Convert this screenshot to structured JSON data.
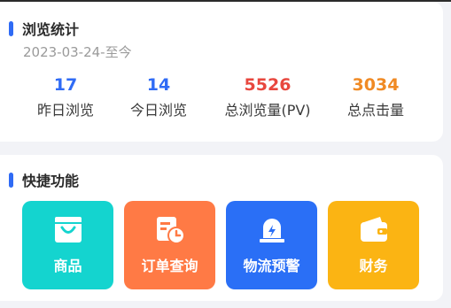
{
  "stats": {
    "title": "浏览统计",
    "date_range": "2023-03-24-至今",
    "metrics": [
      {
        "value": "17",
        "label": "昨日浏览",
        "color": "#2f6bf5"
      },
      {
        "value": "14",
        "label": "今日浏览",
        "color": "#2f6bf5"
      },
      {
        "value": "5526",
        "label": "总浏览量(PV)",
        "color": "#e8473e"
      },
      {
        "value": "3034",
        "label": "总点击量",
        "color": "#f08a24"
      }
    ]
  },
  "quick": {
    "title": "快捷功能",
    "tiles": [
      {
        "label": "商品",
        "icon": "shopping-bag-icon",
        "color": "#14d4cf"
      },
      {
        "label": "订单查询",
        "icon": "order-search-icon",
        "color": "#ff7a45"
      },
      {
        "label": "物流预警",
        "icon": "alarm-light-icon",
        "color": "#2a6ff6"
      },
      {
        "label": "财务",
        "icon": "wallet-icon",
        "color": "#fbb413"
      }
    ]
  }
}
